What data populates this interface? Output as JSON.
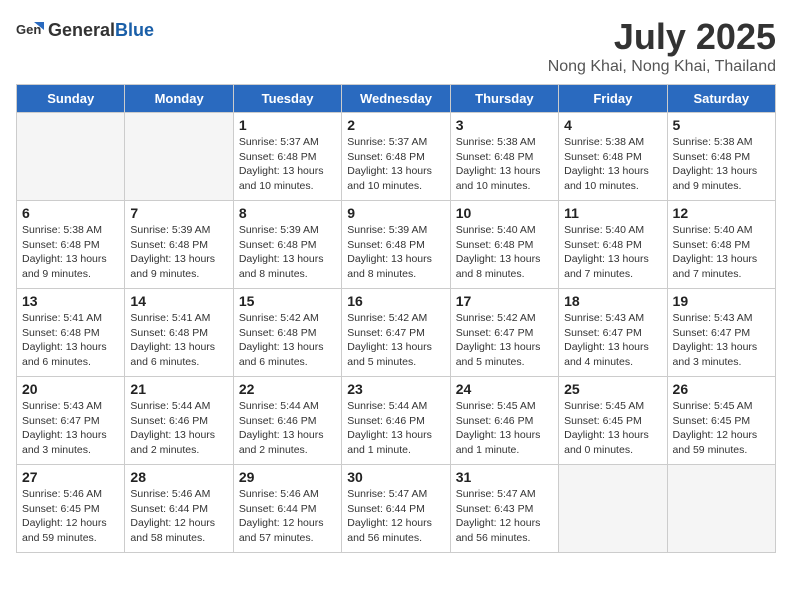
{
  "logo": {
    "general": "General",
    "blue": "Blue"
  },
  "title": "July 2025",
  "subtitle": "Nong Khai, Nong Khai, Thailand",
  "days_of_week": [
    "Sunday",
    "Monday",
    "Tuesday",
    "Wednesday",
    "Thursday",
    "Friday",
    "Saturday"
  ],
  "weeks": [
    [
      {
        "day": "",
        "info": ""
      },
      {
        "day": "",
        "info": ""
      },
      {
        "day": "1",
        "info": "Sunrise: 5:37 AM\nSunset: 6:48 PM\nDaylight: 13 hours\nand 10 minutes."
      },
      {
        "day": "2",
        "info": "Sunrise: 5:37 AM\nSunset: 6:48 PM\nDaylight: 13 hours\nand 10 minutes."
      },
      {
        "day": "3",
        "info": "Sunrise: 5:38 AM\nSunset: 6:48 PM\nDaylight: 13 hours\nand 10 minutes."
      },
      {
        "day": "4",
        "info": "Sunrise: 5:38 AM\nSunset: 6:48 PM\nDaylight: 13 hours\nand 10 minutes."
      },
      {
        "day": "5",
        "info": "Sunrise: 5:38 AM\nSunset: 6:48 PM\nDaylight: 13 hours\nand 9 minutes."
      }
    ],
    [
      {
        "day": "6",
        "info": "Sunrise: 5:38 AM\nSunset: 6:48 PM\nDaylight: 13 hours\nand 9 minutes."
      },
      {
        "day": "7",
        "info": "Sunrise: 5:39 AM\nSunset: 6:48 PM\nDaylight: 13 hours\nand 9 minutes."
      },
      {
        "day": "8",
        "info": "Sunrise: 5:39 AM\nSunset: 6:48 PM\nDaylight: 13 hours\nand 8 minutes."
      },
      {
        "day": "9",
        "info": "Sunrise: 5:39 AM\nSunset: 6:48 PM\nDaylight: 13 hours\nand 8 minutes."
      },
      {
        "day": "10",
        "info": "Sunrise: 5:40 AM\nSunset: 6:48 PM\nDaylight: 13 hours\nand 8 minutes."
      },
      {
        "day": "11",
        "info": "Sunrise: 5:40 AM\nSunset: 6:48 PM\nDaylight: 13 hours\nand 7 minutes."
      },
      {
        "day": "12",
        "info": "Sunrise: 5:40 AM\nSunset: 6:48 PM\nDaylight: 13 hours\nand 7 minutes."
      }
    ],
    [
      {
        "day": "13",
        "info": "Sunrise: 5:41 AM\nSunset: 6:48 PM\nDaylight: 13 hours\nand 6 minutes."
      },
      {
        "day": "14",
        "info": "Sunrise: 5:41 AM\nSunset: 6:48 PM\nDaylight: 13 hours\nand 6 minutes."
      },
      {
        "day": "15",
        "info": "Sunrise: 5:42 AM\nSunset: 6:48 PM\nDaylight: 13 hours\nand 6 minutes."
      },
      {
        "day": "16",
        "info": "Sunrise: 5:42 AM\nSunset: 6:47 PM\nDaylight: 13 hours\nand 5 minutes."
      },
      {
        "day": "17",
        "info": "Sunrise: 5:42 AM\nSunset: 6:47 PM\nDaylight: 13 hours\nand 5 minutes."
      },
      {
        "day": "18",
        "info": "Sunrise: 5:43 AM\nSunset: 6:47 PM\nDaylight: 13 hours\nand 4 minutes."
      },
      {
        "day": "19",
        "info": "Sunrise: 5:43 AM\nSunset: 6:47 PM\nDaylight: 13 hours\nand 3 minutes."
      }
    ],
    [
      {
        "day": "20",
        "info": "Sunrise: 5:43 AM\nSunset: 6:47 PM\nDaylight: 13 hours\nand 3 minutes."
      },
      {
        "day": "21",
        "info": "Sunrise: 5:44 AM\nSunset: 6:46 PM\nDaylight: 13 hours\nand 2 minutes."
      },
      {
        "day": "22",
        "info": "Sunrise: 5:44 AM\nSunset: 6:46 PM\nDaylight: 13 hours\nand 2 minutes."
      },
      {
        "day": "23",
        "info": "Sunrise: 5:44 AM\nSunset: 6:46 PM\nDaylight: 13 hours\nand 1 minute."
      },
      {
        "day": "24",
        "info": "Sunrise: 5:45 AM\nSunset: 6:46 PM\nDaylight: 13 hours\nand 1 minute."
      },
      {
        "day": "25",
        "info": "Sunrise: 5:45 AM\nSunset: 6:45 PM\nDaylight: 13 hours\nand 0 minutes."
      },
      {
        "day": "26",
        "info": "Sunrise: 5:45 AM\nSunset: 6:45 PM\nDaylight: 12 hours\nand 59 minutes."
      }
    ],
    [
      {
        "day": "27",
        "info": "Sunrise: 5:46 AM\nSunset: 6:45 PM\nDaylight: 12 hours\nand 59 minutes."
      },
      {
        "day": "28",
        "info": "Sunrise: 5:46 AM\nSunset: 6:44 PM\nDaylight: 12 hours\nand 58 minutes."
      },
      {
        "day": "29",
        "info": "Sunrise: 5:46 AM\nSunset: 6:44 PM\nDaylight: 12 hours\nand 57 minutes."
      },
      {
        "day": "30",
        "info": "Sunrise: 5:47 AM\nSunset: 6:44 PM\nDaylight: 12 hours\nand 56 minutes."
      },
      {
        "day": "31",
        "info": "Sunrise: 5:47 AM\nSunset: 6:43 PM\nDaylight: 12 hours\nand 56 minutes."
      },
      {
        "day": "",
        "info": ""
      },
      {
        "day": "",
        "info": ""
      }
    ]
  ]
}
